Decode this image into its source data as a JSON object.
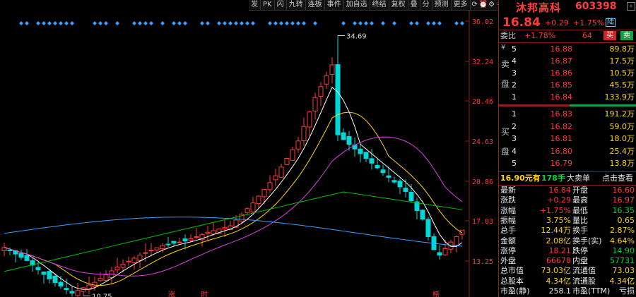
{
  "toolbar": {
    "items": [
      "发",
      "PK",
      "闪",
      "九转",
      "连板",
      "事件",
      "加自选",
      "终结",
      "复权",
      "叠",
      "分",
      "预测",
      "更多"
    ]
  },
  "chart_data": {
    "type": "candlestick",
    "y_ticks": [
      "36.02",
      "32.24",
      "28.46",
      "24.63",
      "20.86",
      "17.03",
      "13.25"
    ],
    "annotations": {
      "high": "34.69",
      "low": "10.75"
    },
    "bottom_marks": [
      "涨",
      "时",
      "榜"
    ],
    "ylim": [
      10.0,
      36.02
    ]
  },
  "quote": {
    "name": "沐邦高科",
    "code": "603398",
    "price": "16.84",
    "change": "+0.29",
    "change_pct": "+1.75%",
    "badge": "陆",
    "weibi_label": "委比",
    "weibi_value": "+1.78%",
    "weicha_value": "64",
    "sell_btn": "买",
    "buy_btn": "卖"
  },
  "sell_side_label": [
    "卖",
    "盘"
  ],
  "buy_side_label": [
    "买",
    "盘"
  ],
  "sell_orders": [
    {
      "level": "5",
      "price": "16.88",
      "vol": "89.8万",
      "color": "red"
    },
    {
      "level": "4",
      "price": "16.87",
      "vol": "17.5万",
      "color": "red"
    },
    {
      "level": "3",
      "price": "16.86",
      "vol": "10.5万",
      "color": "red"
    },
    {
      "level": "2",
      "price": "16.85",
      "vol": "45.5万",
      "color": "red"
    },
    {
      "level": "1",
      "price": "16.84",
      "vol": "133.9万",
      "color": "red"
    }
  ],
  "buy_orders": [
    {
      "level": "1",
      "price": "16.83",
      "vol": "191.2万",
      "color": "red"
    },
    {
      "level": "2",
      "price": "16.82",
      "vol": "59.0万",
      "color": "red"
    },
    {
      "level": "3",
      "price": "16.81",
      "vol": "18.0万",
      "color": "red"
    },
    {
      "level": "4",
      "price": "16.80",
      "vol": "25.4万",
      "color": "red"
    },
    {
      "level": "5",
      "price": "16.79",
      "vol": "13.8万",
      "color": "red"
    }
  ],
  "big_order": {
    "price": "16.90元有",
    "qty": "178手",
    "label": "大卖单",
    "link": "点击查看"
  },
  "stats": [
    {
      "l1": "最新",
      "v1": "16.84",
      "c1": "red",
      "l2": "开盘",
      "v2": "16.60",
      "c2": "red"
    },
    {
      "l1": "涨跌",
      "v1": "+0.29",
      "c1": "red",
      "l2": "最高",
      "v2": "16.97",
      "c2": "red"
    },
    {
      "l1": "涨幅",
      "v1": "+1.75%",
      "c1": "red",
      "l2": "最低",
      "v2": "16.35",
      "c2": "green"
    },
    {
      "l1": "振幅",
      "v1": "3.75%",
      "c1": "yellow",
      "l2": "量比",
      "v2": "0.65",
      "c2": "yellow"
    },
    {
      "l1": "总手",
      "v1": "12.44万",
      "c1": "yellow",
      "l2": "换手",
      "v2": "2.87%",
      "c2": "yellow"
    },
    {
      "l1": "金额",
      "v1": "2.08亿",
      "c1": "yellow",
      "l2": "换手(实)",
      "v2": "4.64%",
      "c2": "yellow"
    },
    {
      "l1": "涨停",
      "v1": "18.21",
      "c1": "red",
      "l2": "跌停",
      "v2": "14.90",
      "c2": "green"
    },
    {
      "l1": "外盘",
      "v1": "66678",
      "c1": "red",
      "l2": "内盘",
      "v2": "57731",
      "c2": "green"
    },
    {
      "l1": "总市值",
      "v1": "73.03亿",
      "c1": "yellow",
      "l2": "流通值",
      "v2": "73.03亿",
      "c2": "yellow"
    },
    {
      "l1": "总股本",
      "v1": "4.34亿",
      "c1": "yellow",
      "l2": "流通股",
      "v2": "4.34亿",
      "c2": "yellow"
    },
    {
      "l1": "市盈(静)",
      "v1": "258.1",
      "c1": "white",
      "l2": "市盈(TTM)",
      "v2": "亏损",
      "c2": "white"
    }
  ],
  "colors": {
    "up": "#ff3b3b",
    "down": "#00d8d8",
    "bg": "#000000",
    "accent": "#8a1f1f"
  }
}
